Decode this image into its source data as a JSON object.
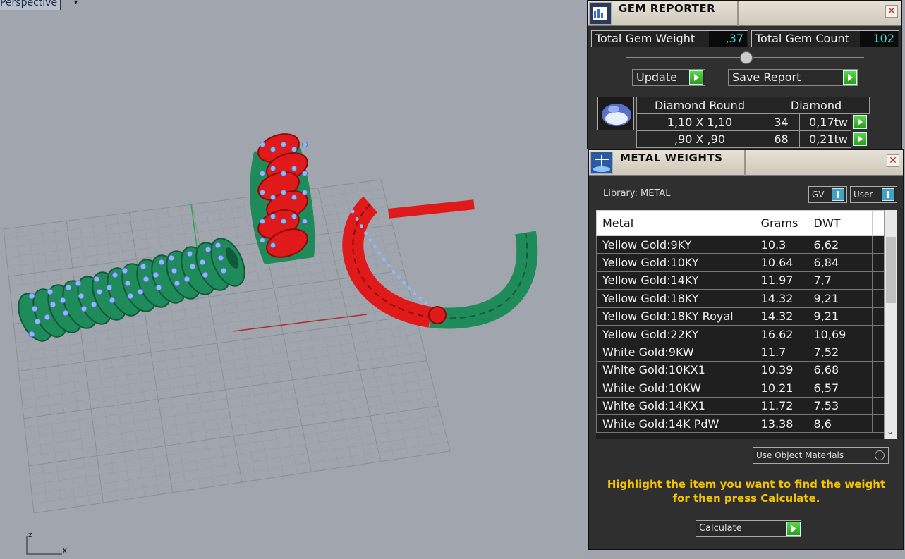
{
  "viewport": {
    "label": "Perspective",
    "axis_x": "x",
    "axis_z": "z"
  },
  "gem_reporter": {
    "title": "GEM REPORTER",
    "close": "✕",
    "total_weight_label": "Total Gem Weight",
    "total_weight_value": ",37",
    "total_count_label": "Total Gem Count",
    "total_count_value": "102",
    "update_label": "Update",
    "save_label": "Save Report",
    "gem_type": "Diamond Round",
    "gem_material": "Diamond",
    "rows": [
      {
        "size": "1,10 X 1,10",
        "count": "34",
        "weight": "0,17tw"
      },
      {
        "size": ",90 X ,90",
        "count": "68",
        "weight": "0,21tw"
      }
    ]
  },
  "metal_weights": {
    "title": "METAL WEIGHTS",
    "close": "✕",
    "library_label": "Library: METAL",
    "gv_label": "GV",
    "user_label": "User",
    "columns": [
      "Metal",
      "Grams",
      "DWT"
    ],
    "rows": [
      {
        "metal": "Yellow Gold:9KY",
        "grams": "10.3",
        "dwt": "6,62"
      },
      {
        "metal": "Yellow Gold:10KY",
        "grams": "10.64",
        "dwt": "6,84"
      },
      {
        "metal": "Yellow Gold:14KY",
        "grams": "11.97",
        "dwt": "7,7"
      },
      {
        "metal": "Yellow Gold:18KY",
        "grams": "14.32",
        "dwt": "9,21"
      },
      {
        "metal": "Yellow Gold:18KY Royal",
        "grams": "14.32",
        "dwt": "9,21"
      },
      {
        "metal": "Yellow Gold:22KY",
        "grams": "16.62",
        "dwt": "10,69"
      },
      {
        "metal": "White Gold:9KW",
        "grams": "11.7",
        "dwt": "7,52"
      },
      {
        "metal": "White Gold:10KX1",
        "grams": "10.39",
        "dwt": "6,68"
      },
      {
        "metal": "White Gold:10KW",
        "grams": "10.21",
        "dwt": "6,57"
      },
      {
        "metal": "White Gold:14KX1",
        "grams": "11.72",
        "dwt": "7,53"
      },
      {
        "metal": "White Gold:14K PdW",
        "grams": "13.38",
        "dwt": "8,6"
      }
    ],
    "use_object_materials": "Use Object Materials",
    "hint": "Highlight the item you want to find the weight for then press Calculate.",
    "calculate_label": "Calculate"
  },
  "colors": {
    "accent_green": "#2f9a22",
    "value_cyan": "#3ee0e0",
    "hint_yellow": "#f5c400",
    "model_green": "#1f8a5a",
    "model_red": "#e01a1a",
    "gem_blue": "#8fb8f5"
  }
}
